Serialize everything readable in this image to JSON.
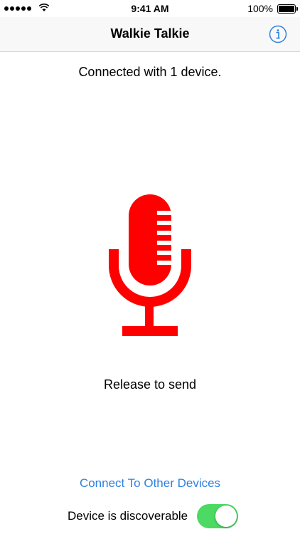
{
  "status_bar": {
    "time": "9:41 AM",
    "battery_percent": "100%",
    "signal_bars": 5,
    "battery_level": 1.0
  },
  "nav": {
    "title": "Walkie Talkie",
    "info_icon": "info-icon"
  },
  "main": {
    "connection_status": "Connected with 1 device.",
    "mic_icon": "microphone-icon",
    "mic_color": "#ff0000",
    "hint": "Release to send",
    "connect_link": "Connect To Other Devices",
    "discoverable_label": "Device is discoverable",
    "discoverable_on": true
  },
  "colors": {
    "accent": "#2f80e0",
    "toggle_on": "#4cd964",
    "mic": "#ff0000"
  }
}
